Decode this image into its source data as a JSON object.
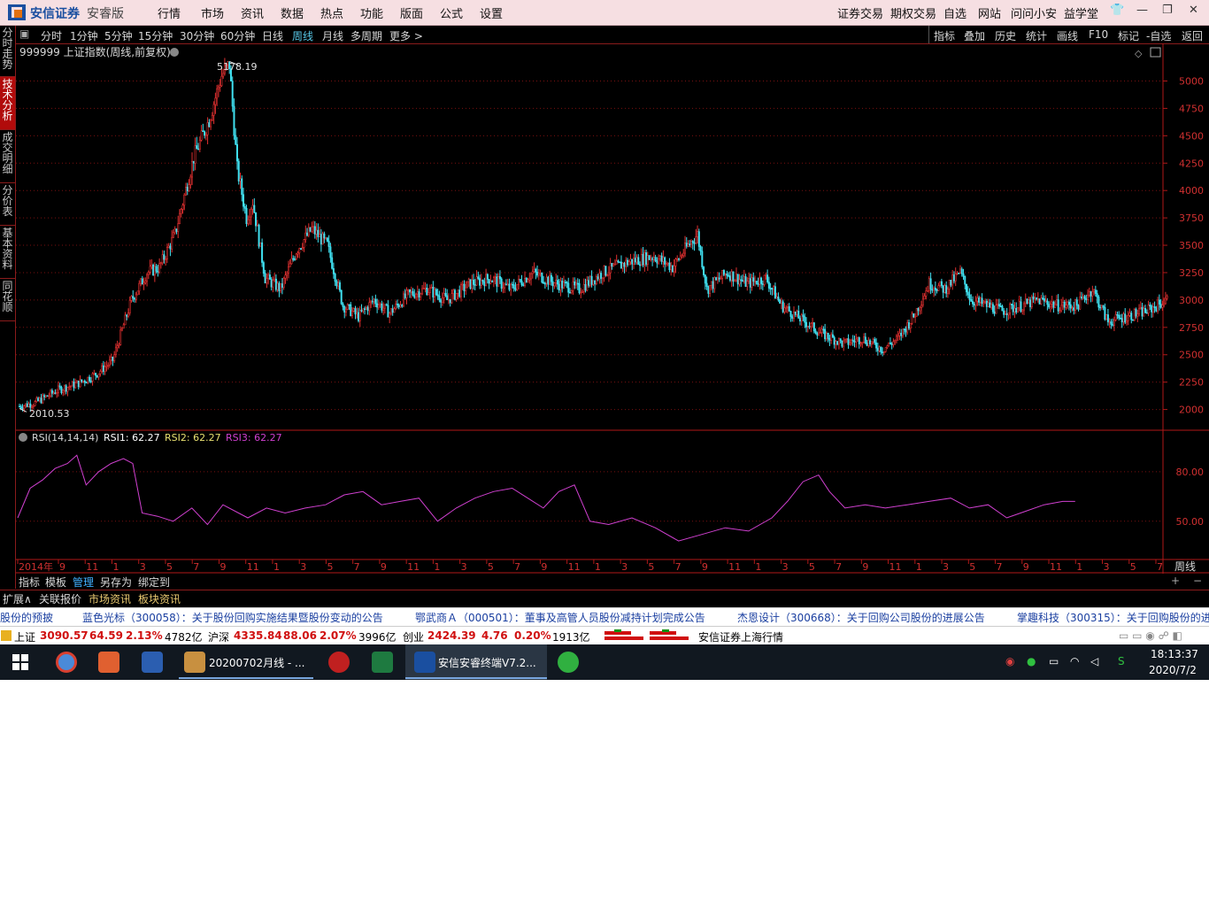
{
  "titlebar": {
    "brand": "安信证券",
    "edition": "安睿版",
    "menu": [
      "行情",
      "市场",
      "资讯",
      "数据",
      "热点",
      "功能",
      "版面",
      "公式",
      "设置"
    ],
    "right_menu": [
      "证券交易",
      "期权交易",
      "自选",
      "网站",
      "问问小安",
      "益学堂"
    ]
  },
  "left_tabs": [
    "分时走势",
    "技术分析",
    "成交明细",
    "分价表",
    "基本资料",
    "同花顺"
  ],
  "period_tabs": [
    "分时",
    "1分钟",
    "5分钟",
    "15分钟",
    "30分钟",
    "60分钟",
    "日线",
    "周线",
    "月线",
    "多周期",
    "更多 >"
  ],
  "active_period": "周线",
  "right_tools": [
    "指标",
    "叠加",
    "历史",
    "统计",
    "画线",
    "F10",
    "标记",
    "-自选",
    "返回"
  ],
  "chart": {
    "title": "999999 上证指数(周线,前复权)",
    "high_label": "5178.19",
    "low_label": "2010.53",
    "rsi_title": "RSI(14,14,14)",
    "rsi1": "RSI1: 62.27",
    "rsi2": "RSI2: 62.27",
    "rsi3": "RSI3: 62.27",
    "period_label": "周线"
  },
  "chart_data": [
    {
      "type": "candlestick",
      "title": "999999 上证指数(周线,前复权)",
      "y_ticks": [
        2000,
        2250,
        2500,
        2750,
        3000,
        3250,
        3500,
        3750,
        4000,
        4250,
        4500,
        4750,
        5000
      ],
      "ylim": [
        1940,
        5190
      ],
      "x_ticks": [
        "2014年",
        "9",
        "11",
        "1",
        "3",
        "5",
        "7",
        "9",
        "11",
        "1",
        "3",
        "5",
        "7",
        "9",
        "11",
        "1",
        "3",
        "5",
        "7",
        "9",
        "11",
        "1",
        "3",
        "5",
        "7",
        "9",
        "11",
        "1",
        "3",
        "5",
        "7",
        "9",
        "11",
        "1",
        "3",
        "5",
        "7",
        "9",
        "11",
        "1",
        "3",
        "5",
        "7"
      ],
      "close_path": [
        [
          0,
          2030
        ],
        [
          10,
          2060
        ],
        [
          25,
          2180
        ],
        [
          38,
          2240
        ],
        [
          50,
          2330
        ],
        [
          60,
          2450
        ],
        [
          72,
          3000
        ],
        [
          82,
          3250
        ],
        [
          90,
          3300
        ],
        [
          100,
          3600
        ],
        [
          112,
          4300
        ],
        [
          122,
          4650
        ],
        [
          130,
          5050
        ],
        [
          135,
          5150
        ],
        [
          140,
          4200
        ],
        [
          146,
          3750
        ],
        [
          150,
          3900
        ],
        [
          158,
          3200
        ],
        [
          168,
          3100
        ],
        [
          178,
          3450
        ],
        [
          188,
          3650
        ],
        [
          198,
          3500
        ],
        [
          208,
          2950
        ],
        [
          218,
          2850
        ],
        [
          228,
          3000
        ],
        [
          238,
          2880
        ],
        [
          250,
          3050
        ],
        [
          262,
          3100
        ],
        [
          275,
          3000
        ],
        [
          290,
          3150
        ],
        [
          303,
          3200
        ],
        [
          316,
          3100
        ],
        [
          330,
          3250
        ],
        [
          345,
          3150
        ],
        [
          360,
          3100
        ],
        [
          375,
          3250
        ],
        [
          392,
          3350
        ],
        [
          408,
          3400
        ],
        [
          420,
          3300
        ],
        [
          430,
          3500
        ],
        [
          436,
          3600
        ],
        [
          442,
          3100
        ],
        [
          455,
          3250
        ],
        [
          468,
          3150
        ],
        [
          480,
          3200
        ],
        [
          490,
          2950
        ],
        [
          500,
          2850
        ],
        [
          515,
          2700
        ],
        [
          530,
          2600
        ],
        [
          542,
          2650
        ],
        [
          555,
          2550
        ],
        [
          565,
          2650
        ],
        [
          575,
          2850
        ],
        [
          585,
          3150
        ],
        [
          595,
          3100
        ],
        [
          605,
          3250
        ],
        [
          612,
          3000
        ],
        [
          622,
          2950
        ],
        [
          632,
          2900
        ],
        [
          645,
          2950
        ],
        [
          655,
          3000
        ],
        [
          668,
          2950
        ],
        [
          680,
          2950
        ],
        [
          690,
          3100
        ],
        [
          700,
          2800
        ],
        [
          712,
          2850
        ],
        [
          725,
          2900
        ],
        [
          738,
          3000
        ]
      ],
      "rsi_series": [
        {
          "name": "RSI1",
          "y_ticks": [
            50,
            80
          ],
          "ylim": [
            30,
            95
          ],
          "path": [
            [
              0,
              52
            ],
            [
              8,
              70
            ],
            [
              16,
              75
            ],
            [
              24,
              82
            ],
            [
              32,
              85
            ],
            [
              38,
              90
            ],
            [
              44,
              72
            ],
            [
              52,
              80
            ],
            [
              60,
              85
            ],
            [
              68,
              88
            ],
            [
              74,
              85
            ],
            [
              80,
              55
            ],
            [
              90,
              53
            ],
            [
              100,
              50
            ],
            [
              112,
              58
            ],
            [
              122,
              48
            ],
            [
              132,
              60
            ],
            [
              148,
              52
            ],
            [
              160,
              58
            ],
            [
              172,
              55
            ],
            [
              185,
              58
            ],
            [
              198,
              60
            ],
            [
              210,
              66
            ],
            [
              222,
              68
            ],
            [
              234,
              60
            ],
            [
              246,
              62
            ],
            [
              258,
              64
            ],
            [
              270,
              50
            ],
            [
              282,
              58
            ],
            [
              294,
              64
            ],
            [
              306,
              68
            ],
            [
              318,
              70
            ],
            [
              328,
              64
            ],
            [
              338,
              58
            ],
            [
              348,
              68
            ],
            [
              358,
              72
            ],
            [
              368,
              50
            ],
            [
              380,
              48
            ],
            [
              395,
              52
            ],
            [
              410,
              46
            ],
            [
              425,
              38
            ],
            [
              440,
              42
            ],
            [
              455,
              46
            ],
            [
              470,
              44
            ],
            [
              485,
              52
            ],
            [
              495,
              62
            ],
            [
              505,
              74
            ],
            [
              515,
              78
            ],
            [
              522,
              68
            ],
            [
              532,
              58
            ],
            [
              545,
              60
            ],
            [
              558,
              58
            ],
            [
              572,
              60
            ],
            [
              586,
              62
            ],
            [
              600,
              64
            ],
            [
              612,
              58
            ],
            [
              624,
              60
            ],
            [
              636,
              52
            ],
            [
              648,
              56
            ],
            [
              660,
              60
            ],
            [
              672,
              62
            ],
            [
              680,
              62
            ]
          ]
        }
      ]
    }
  ],
  "bottom_tabs": [
    "指标",
    "模板",
    "管理",
    "另存为",
    "绑定到"
  ],
  "info_tabs": [
    "扩展∧",
    "关联报价",
    "市场资讯",
    "板块资讯"
  ],
  "news": [
    "股份的预披",
    "蓝色光标（300058）：关于股份回购实施结果暨股份变动的公告",
    "鄂武商Ａ（000501）：董事及高管人员股份减持计划完成公告",
    "杰恩设计（300668）：关于回购公司股份的进展公告",
    "掌趣科技（300315）：关于回购股份的进"
  ],
  "quotes": [
    {
      "name": "上证",
      "price": "3090.57",
      "chg": "64.59",
      "pct": "2.13%",
      "vol": "4782亿"
    },
    {
      "name": "沪深",
      "price": "4335.84",
      "chg": "88.06",
      "pct": "2.07%",
      "vol": "3996亿"
    },
    {
      "name": "创业",
      "price": "2424.39",
      "chg": "4.76",
      "pct": "0.20%",
      "vol": "1913亿"
    }
  ],
  "quote_broker": "安信证券上海行情",
  "taskbar": {
    "window1": "20200702月线 - ...",
    "window2": "安信安睿终端V7.2...",
    "time": "18:13:37",
    "date": "2020/7/2"
  }
}
